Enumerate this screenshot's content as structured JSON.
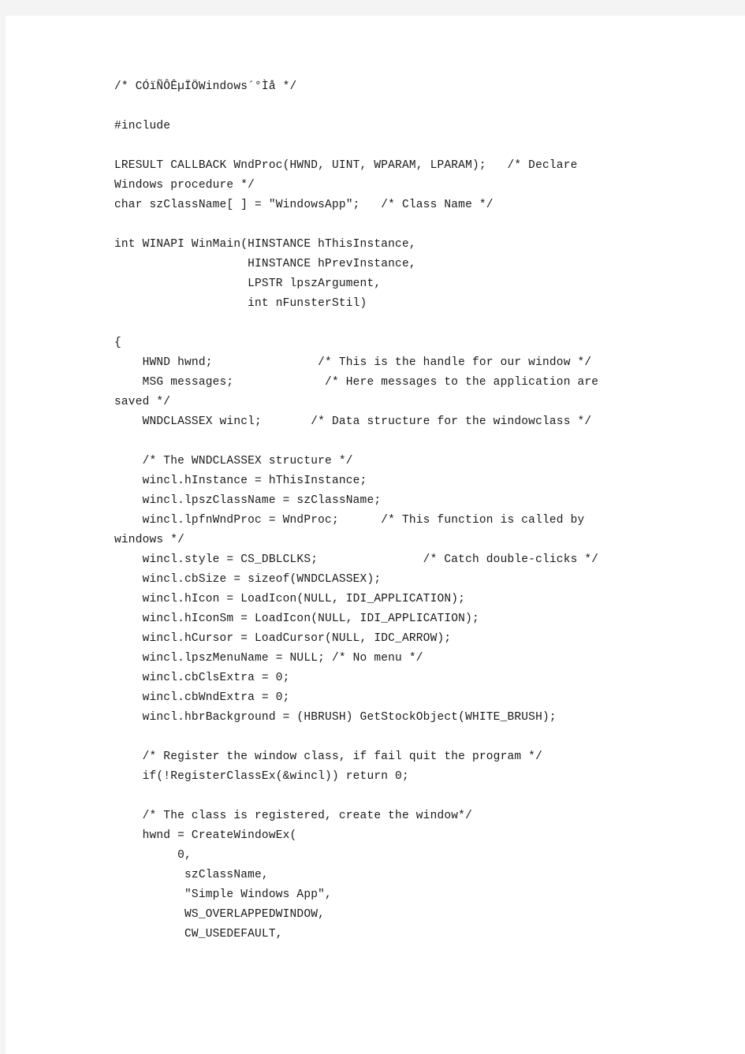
{
  "page": {
    "title": "Simple Windows Application Source Code",
    "background_color": "#ffffff",
    "border_color": "#f4f4f4",
    "text_color": "#1a1a1a",
    "font": "monospace",
    "line_height_px": 25
  },
  "code": {
    "language": "c",
    "lines": [
      "/* CÓïÑÔÊµÏÖWindows´°Ìå */",
      "",
      "#include",
      "",
      "LRESULT CALLBACK WndProc(HWND, UINT, WPARAM, LPARAM);   /* Declare",
      "Windows procedure */",
      "char szClassName[ ] = \"WindowsApp\";   /* Class Name */",
      "",
      "int WINAPI WinMain(HINSTANCE hThisInstance,",
      "                   HINSTANCE hPrevInstance,",
      "                   LPSTR lpszArgument,",
      "                   int nFunsterStil)",
      "",
      "{",
      "    HWND hwnd;               /* This is the handle for our window */",
      "    MSG messages;             /* Here messages to the application are",
      "saved */",
      "    WNDCLASSEX wincl;       /* Data structure for the windowclass */",
      "",
      "    /* The WNDCLASSEX structure */",
      "    wincl.hInstance = hThisInstance;",
      "    wincl.lpszClassName = szClassName;",
      "    wincl.lpfnWndProc = WndProc;      /* This function is called by",
      "windows */",
      "    wincl.style = CS_DBLCLKS;               /* Catch double-clicks */",
      "    wincl.cbSize = sizeof(WNDCLASSEX);",
      "    wincl.hIcon = LoadIcon(NULL, IDI_APPLICATION);",
      "    wincl.hIconSm = LoadIcon(NULL, IDI_APPLICATION);",
      "    wincl.hCursor = LoadCursor(NULL, IDC_ARROW);",
      "    wincl.lpszMenuName = NULL; /* No menu */",
      "    wincl.cbClsExtra = 0;",
      "    wincl.cbWndExtra = 0;",
      "    wincl.hbrBackground = (HBRUSH) GetStockObject(WHITE_BRUSH);",
      "",
      "    /* Register the window class, if fail quit the program */",
      "    if(!RegisterClassEx(&wincl)) return 0;",
      "",
      "    /* The class is registered, create the window*/",
      "    hwnd = CreateWindowEx(",
      "         0,",
      "          szClassName,",
      "          \"Simple Windows App\",",
      "          WS_OVERLAPPEDWINDOW,",
      "          CW_USEDEFAULT,"
    ]
  }
}
